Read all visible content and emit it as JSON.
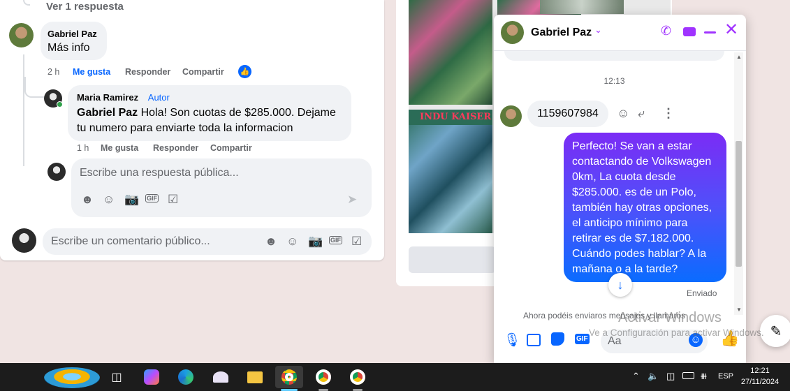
{
  "feed": {
    "view_replies": "Ver 1 respuesta",
    "comment1": {
      "name": "Gabriel Paz",
      "text": "Más info",
      "time": "2 h",
      "like": "Me gusta",
      "reply": "Responder",
      "share": "Compartir"
    },
    "comment2": {
      "name": "Maria Ramirez",
      "badge": "Autor",
      "mention": "Gabriel Paz",
      "text": " Hola! Son cuotas de $285.000. Dejame tu numero para enviarte toda la informacion",
      "time": "1 h",
      "like": "Me gusta",
      "reply": "Responder",
      "share": "Compartir"
    },
    "reply_placeholder": "Escribe una respuesta pública...",
    "comment_placeholder": "Escribe un comentario público..."
  },
  "post": {
    "banner_text": "INDU KAISER"
  },
  "chat": {
    "title": "Gabriel Paz",
    "timestamp": "12:13",
    "incoming": "1159607984",
    "outgoing": "Perfecto!  Se van a estar contactando de Volkswagen 0km, La cuota desde $285.000. es de un Polo, también hay otras opciones, el anticipo mínimo para retirar es de $7.182.000. Cuándo podes hablar? A la mañana o a la tarde?",
    "status": "Enviado",
    "notice": "Ahora podéis enviaros mensajes y llamaros",
    "input_placeholder": "Aa",
    "colors": {
      "accent": "#a033ff",
      "bubble_start": "#7b2cf5",
      "bubble_end": "#0a6cff"
    }
  },
  "watermark": {
    "line1": "Activar Windows",
    "line2": "Ve a Configuración para activar Windows."
  },
  "taskbar": {
    "lang": "ESP",
    "time": "12:21",
    "date": "27/11/2024"
  }
}
